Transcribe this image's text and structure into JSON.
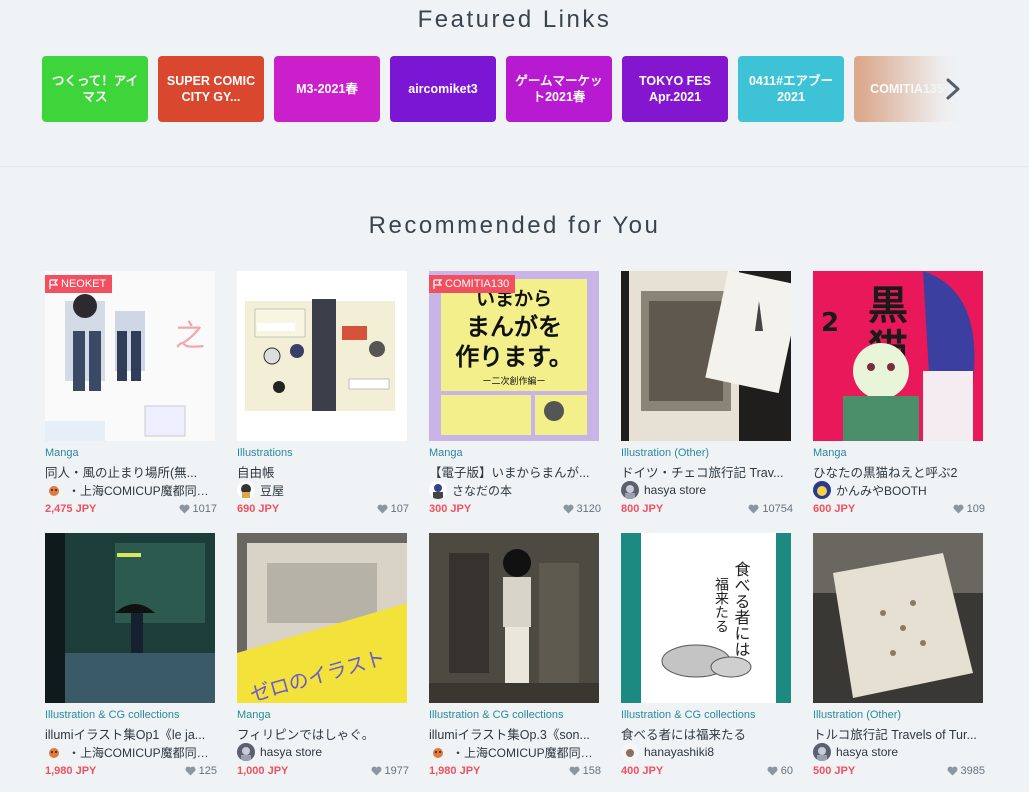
{
  "featured": {
    "title": "Featured Links",
    "links": [
      {
        "label": "つくって！アイマス",
        "color": "#3dd53a"
      },
      {
        "label": "SUPER COMIC CITY GY...",
        "color": "#d9472f"
      },
      {
        "label": "M3-2021春",
        "color": "#cc1fcc"
      },
      {
        "label": "aircomiket3",
        "color": "#7b16d4"
      },
      {
        "label": "ゲームマーケット2021春",
        "color": "#b71ad0"
      },
      {
        "label": "TOKYO FES Apr.2021",
        "color": "#8516d0"
      },
      {
        "label": "0411#エアブー2021",
        "color": "#3ec3d6"
      },
      {
        "label": "COMITIA135",
        "color": "#dba98e"
      }
    ],
    "next_icon": "chevron-right-icon"
  },
  "recommended": {
    "title": "Recommended for You",
    "items": [
      {
        "badge": "NEOKET",
        "category": "Manga",
        "title": "同人・風の止まり場所(無...",
        "shop": "・上海COMICUP魔都同人...",
        "price": "2,475 JPY",
        "likes": "1017"
      },
      {
        "badge": "",
        "category": "Illustrations",
        "title": "自由帳",
        "shop": "豆屋",
        "price": "690 JPY",
        "likes": "107"
      },
      {
        "badge": "COMITIA130",
        "category": "Manga",
        "title": "【電子版】いまからまんが...",
        "shop": "さなだの本",
        "price": "300 JPY",
        "likes": "3120"
      },
      {
        "badge": "",
        "category": "Illustration (Other)",
        "title": "ドイツ・チェコ旅行記 Trav...",
        "shop": "hasya store",
        "price": "800 JPY",
        "likes": "10754"
      },
      {
        "badge": "",
        "category": "Manga",
        "title": "ひなたの黒猫ねえと呼ぶ2",
        "shop": "かんみやBOOTH",
        "price": "600 JPY",
        "likes": "109"
      },
      {
        "badge": "",
        "category": "Illustration & CG collections",
        "title": "illumiイラスト集Op1《le ja...",
        "shop": "・上海COMICUP魔都同人...",
        "price": "1,980 JPY",
        "likes": "125"
      },
      {
        "badge": "",
        "category": "Manga",
        "title": "フィリピンではしゃぐ。",
        "shop": "hasya store",
        "price": "1,000 JPY",
        "likes": "1977"
      },
      {
        "badge": "",
        "category": "Illustration & CG collections",
        "title": "illumiイラスト集Op.3《son...",
        "shop": "・上海COMICUP魔都同人...",
        "price": "1,980 JPY",
        "likes": "158"
      },
      {
        "badge": "",
        "category": "Illustration & CG collections",
        "title": "食べる者には福来たる",
        "shop": "hanayashiki8",
        "price": "400 JPY",
        "likes": "60"
      },
      {
        "badge": "",
        "category": "Illustration (Other)",
        "title": "トルコ旅行記 Travels of Tur...",
        "shop": "hasya store",
        "price": "500 JPY",
        "likes": "3985"
      }
    ],
    "cover_text": {
      "item3_line1": "いまから",
      "item3_line2": "まんがを",
      "item3_line3": "作ります。",
      "item3_line4": "ー二次創作編ー",
      "item5_line1": "黒",
      "item5_line2": "猫",
      "item9_line1": "食べる者には",
      "item9_line2": "福来たる",
      "item7_line1": "ゼロのイラスト"
    }
  }
}
